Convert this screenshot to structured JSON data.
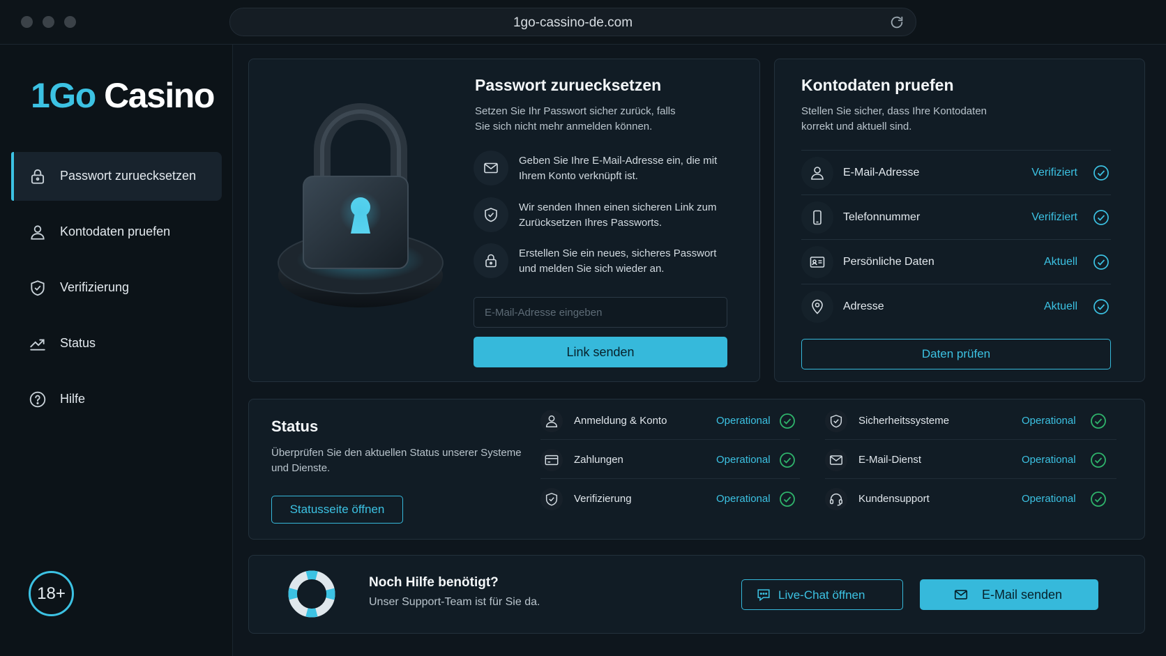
{
  "browser": {
    "url": "1go-cassino-de.com"
  },
  "sidebar": {
    "logo_part1": "1Go",
    "logo_part2": "Casino",
    "items": [
      {
        "label": "Passwort zuruecksetzen",
        "icon": "lock-icon",
        "active": true
      },
      {
        "label": "Kontodaten pruefen",
        "icon": "user-icon",
        "active": false
      },
      {
        "label": "Verifizierung",
        "icon": "shield-check-icon",
        "active": false
      },
      {
        "label": "Status",
        "icon": "trend-chart-icon",
        "active": false
      },
      {
        "label": "Hilfe",
        "icon": "help-circle-icon",
        "active": false
      }
    ],
    "age_badge": "18+"
  },
  "reset": {
    "title": "Passwort zuruecksetzen",
    "subtitle_line1": "Setzen Sie Ihr Passwort sicher zurück, falls",
    "subtitle_line2": "Sie sich nicht mehr anmelden können.",
    "steps": [
      {
        "icon": "mail-icon",
        "text": "Geben Sie Ihre E-Mail-Adresse ein, die mit Ihrem Konto verknüpft ist."
      },
      {
        "icon": "shield-check-icon",
        "text": "Wir senden Ihnen einen sicheren Link zum Zurücksetzen Ihres Passworts."
      },
      {
        "icon": "lock-icon",
        "text": "Erstellen Sie ein neues, sicheres Passwort und melden Sie sich wieder an."
      }
    ],
    "email_placeholder": "E-Mail-Adresse eingeben",
    "email_value": "",
    "submit_label": "Link senden"
  },
  "account": {
    "title": "Kontodaten pruefen",
    "subtitle_line1": "Stellen Sie sicher, dass Ihre Kontodaten",
    "subtitle_line2": "korrekt und aktuell sind.",
    "rows": [
      {
        "icon": "user-icon",
        "label": "E-Mail-Adresse",
        "status": "Verifiziert"
      },
      {
        "icon": "phone-icon",
        "label": "Telefonnummer",
        "status": "Verifiziert"
      },
      {
        "icon": "id-card-icon",
        "label": "Persönliche Daten",
        "status": "Aktuell"
      },
      {
        "icon": "location-pin-icon",
        "label": "Adresse",
        "status": "Aktuell"
      }
    ],
    "check_button": "Daten prüfen"
  },
  "status": {
    "title": "Status",
    "description_line1": "Überprüfen Sie den aktuellen Status unserer Systeme",
    "description_line2": "und Dienste.",
    "open_button": "Statusseite öffnen",
    "services": [
      {
        "icon": "user-icon",
        "label": "Anmeldung & Konto",
        "state": "Operational"
      },
      {
        "icon": "credit-card-icon",
        "label": "Zahlungen",
        "state": "Operational"
      },
      {
        "icon": "shield-check-icon",
        "label": "Verifizierung",
        "state": "Operational"
      },
      {
        "icon": "shield-check-icon",
        "label": "Sicherheitssysteme",
        "state": "Operational"
      },
      {
        "icon": "mail-icon",
        "label": "E-Mail-Dienst",
        "state": "Operational"
      },
      {
        "icon": "headset-icon",
        "label": "Kundensupport",
        "state": "Operational"
      }
    ]
  },
  "help": {
    "title": "Noch Hilfe benötigt?",
    "subtitle": "Unser Support-Team ist für Sie da.",
    "chat_button": "Live-Chat öffnen",
    "email_button": "E-Mail senden"
  },
  "colors": {
    "accent": "#3cc2e3",
    "success": "#2fb36b",
    "background": "#0e161d",
    "card": "#111c25"
  }
}
